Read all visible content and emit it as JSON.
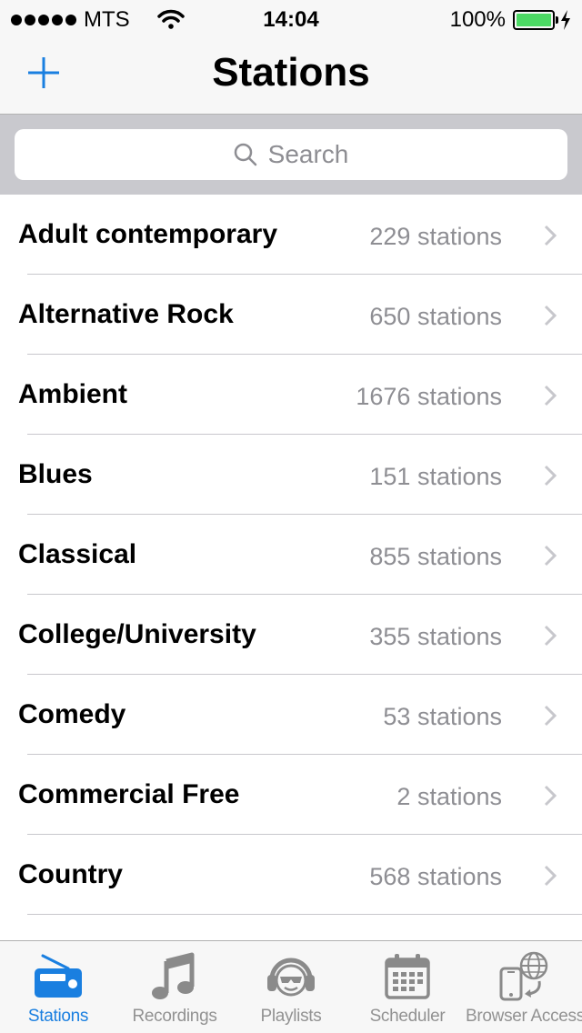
{
  "status_bar": {
    "carrier": "MTS",
    "time": "14:04",
    "battery": "100%"
  },
  "nav": {
    "title": "Stations",
    "add_icon": "plus-icon"
  },
  "search": {
    "placeholder": "Search",
    "icon": "search-icon"
  },
  "genres": [
    {
      "name": "Adult contemporary",
      "count": "229 stations"
    },
    {
      "name": "Alternative Rock",
      "count": "650 stations"
    },
    {
      "name": "Ambient",
      "count": "1676 stations"
    },
    {
      "name": "Blues",
      "count": "151 stations"
    },
    {
      "name": "Classical",
      "count": "855 stations"
    },
    {
      "name": "College/University",
      "count": "355 stations"
    },
    {
      "name": "Comedy",
      "count": "53 stations"
    },
    {
      "name": "Commercial Free",
      "count": "2 stations"
    },
    {
      "name": "Country",
      "count": "568 stations"
    }
  ],
  "tabs": [
    {
      "label": "Stations",
      "icon": "radio-icon",
      "active": true
    },
    {
      "label": "Recordings",
      "icon": "music-note-icon",
      "active": false
    },
    {
      "label": "Playlists",
      "icon": "headphones-face-icon",
      "active": false
    },
    {
      "label": "Scheduler",
      "icon": "calendar-icon",
      "active": false
    },
    {
      "label": "Browser Access",
      "icon": "phone-globe-icon",
      "active": false
    }
  ],
  "colors": {
    "accent": "#1a7fe0",
    "battery": "#4cd964",
    "inactive": "#929292",
    "secondary_text": "#8e8e93"
  }
}
